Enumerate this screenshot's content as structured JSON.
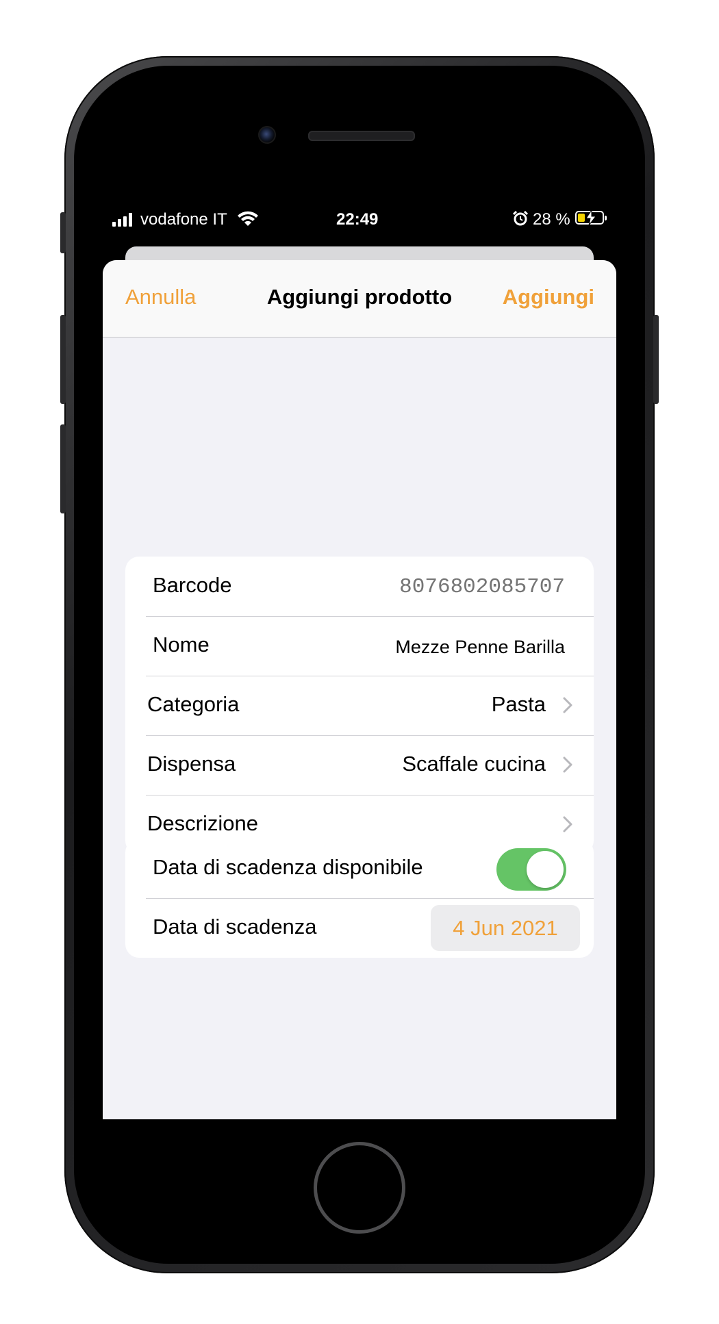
{
  "status_bar": {
    "carrier": "vodafone IT",
    "time": "22:49",
    "battery_percent": "28 %",
    "battery_level": 0.28,
    "icons": [
      "signal-icon",
      "wifi-icon",
      "alarm-icon",
      "battery-charging-icon"
    ]
  },
  "nav": {
    "cancel_label": "Annulla",
    "title": "Aggiungi prodotto",
    "add_label": "Aggiungi"
  },
  "product": {
    "barcode_label": "Barcode",
    "barcode_placeholder": "8076802085707",
    "name_label": "Nome",
    "name_value": "Mezze Penne Barilla",
    "category_label": "Categoria",
    "category_value": "Pasta",
    "pantry_label": "Dispensa",
    "pantry_value": "Scaffale cucina",
    "description_label": "Descrizione"
  },
  "expiry": {
    "available_label": "Data di scadenza disponibile",
    "available_on": true,
    "date_label": "Data di scadenza",
    "date_value": "4 Jun 2021"
  },
  "colors": {
    "accent": "#f0a13a",
    "toggle_on": "#65c466",
    "grouped_background": "#f2f2f7"
  }
}
